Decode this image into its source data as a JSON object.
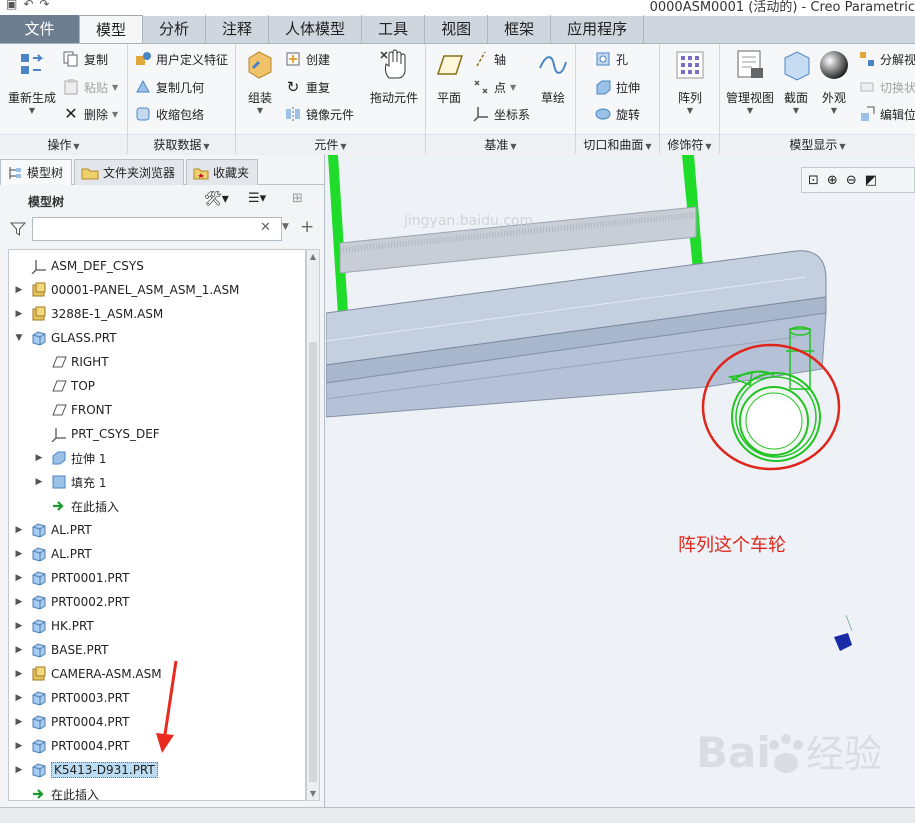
{
  "window": {
    "title": "0000ASM0001 (活动的) - Creo Parametric"
  },
  "ribbon": {
    "tabs": [
      "文件",
      "模型",
      "分析",
      "注释",
      "人体模型",
      "工具",
      "视图",
      "框架",
      "应用程序"
    ],
    "active_tab": "模型",
    "groups": {
      "operations": {
        "label": "操作",
        "regen": "重新生成",
        "copy": "复制",
        "paste": "粘贴",
        "delete": "删除"
      },
      "get_data": {
        "label": "获取数据",
        "udf": "用户定义特征",
        "copy_geom": "复制几何",
        "shrinkwrap": "收缩包络"
      },
      "components": {
        "label": "元件",
        "assemble": "组装",
        "create": "创建",
        "repeat": "重复",
        "mirror": "镜像元件",
        "drag": "拖动元件"
      },
      "datum": {
        "label": "基准",
        "plane": "平面",
        "axis": "轴",
        "point": "点",
        "csys": "坐标系",
        "sketch": "草绘"
      },
      "cut_surface": {
        "label": "切口和曲面",
        "hole": "孔",
        "extrude": "拉伸",
        "revolve": "旋转"
      },
      "modifiers": {
        "label": "修饰符",
        "pattern": "阵列"
      },
      "model_display": {
        "label": "模型显示",
        "manage_views": "管理视图",
        "section": "截面",
        "appearance": "外观",
        "exploded": "分解视",
        "toggle": "切换状",
        "edit_pos": "编辑位"
      }
    }
  },
  "panel": {
    "tabs": [
      "模型树",
      "文件夹浏览器",
      "收藏夹"
    ],
    "tree_label": "模型树",
    "filter_value": ""
  },
  "tree": [
    {
      "label": "ASM_DEF_CSYS",
      "icon": "csys-icon",
      "indent": 0,
      "expander": ""
    },
    {
      "label": "00001-PANEL_ASM_ASM_1.ASM",
      "icon": "assembly-icon",
      "indent": 0,
      "expander": "▶"
    },
    {
      "label": "3288E-1_ASM.ASM",
      "icon": "assembly-icon",
      "indent": 0,
      "expander": "▶"
    },
    {
      "label": "GLASS.PRT",
      "icon": "part-icon",
      "indent": 0,
      "expander": "▼"
    },
    {
      "label": "RIGHT",
      "icon": "datum-plane-icon",
      "indent": 1,
      "expander": ""
    },
    {
      "label": "TOP",
      "icon": "datum-plane-icon",
      "indent": 1,
      "expander": ""
    },
    {
      "label": "FRONT",
      "icon": "datum-plane-icon",
      "indent": 1,
      "expander": ""
    },
    {
      "label": "PRT_CSYS_DEF",
      "icon": "csys-icon",
      "indent": 1,
      "expander": ""
    },
    {
      "label": "拉伸 1",
      "icon": "extrude-icon",
      "indent": 1,
      "expander": "▶"
    },
    {
      "label": "填充 1",
      "icon": "fill-icon",
      "indent": 1,
      "expander": "▶"
    },
    {
      "label": "在此插入",
      "icon": "insert-here-icon",
      "indent": 1,
      "expander": ""
    },
    {
      "label": "AL.PRT",
      "icon": "part-icon",
      "indent": 0,
      "expander": "▶"
    },
    {
      "label": "AL.PRT",
      "icon": "part-icon",
      "indent": 0,
      "expander": "▶"
    },
    {
      "label": "PRT0001.PRT",
      "icon": "part-icon",
      "indent": 0,
      "expander": "▶"
    },
    {
      "label": "PRT0002.PRT",
      "icon": "part-icon",
      "indent": 0,
      "expander": "▶"
    },
    {
      "label": "HK.PRT",
      "icon": "part-icon",
      "indent": 0,
      "expander": "▶"
    },
    {
      "label": "BASE.PRT",
      "icon": "part-icon",
      "indent": 0,
      "expander": "▶"
    },
    {
      "label": "CAMERA-ASM.ASM",
      "icon": "assembly-icon",
      "indent": 0,
      "expander": "▶"
    },
    {
      "label": "PRT0003.PRT",
      "icon": "part-icon",
      "indent": 0,
      "expander": "▶"
    },
    {
      "label": "PRT0004.PRT",
      "icon": "part-icon",
      "indent": 0,
      "expander": "▶"
    },
    {
      "label": "PRT0004.PRT",
      "icon": "part-icon",
      "indent": 0,
      "expander": "▶"
    },
    {
      "label": "K5413-D931.PRT",
      "icon": "part-icon",
      "indent": 0,
      "expander": "▶",
      "selected": true
    },
    {
      "label": "在此插入",
      "icon": "insert-here-icon",
      "indent": 0,
      "expander": ""
    }
  ],
  "viewport": {
    "annotation": "阵列这个车轮"
  },
  "watermark": {
    "text": "jingyan.baidu.com"
  },
  "colors": {
    "annotation": "#e0261c",
    "highlight": "#22d022",
    "model": "#b7c4d8",
    "selection": "#bcdcf4"
  }
}
